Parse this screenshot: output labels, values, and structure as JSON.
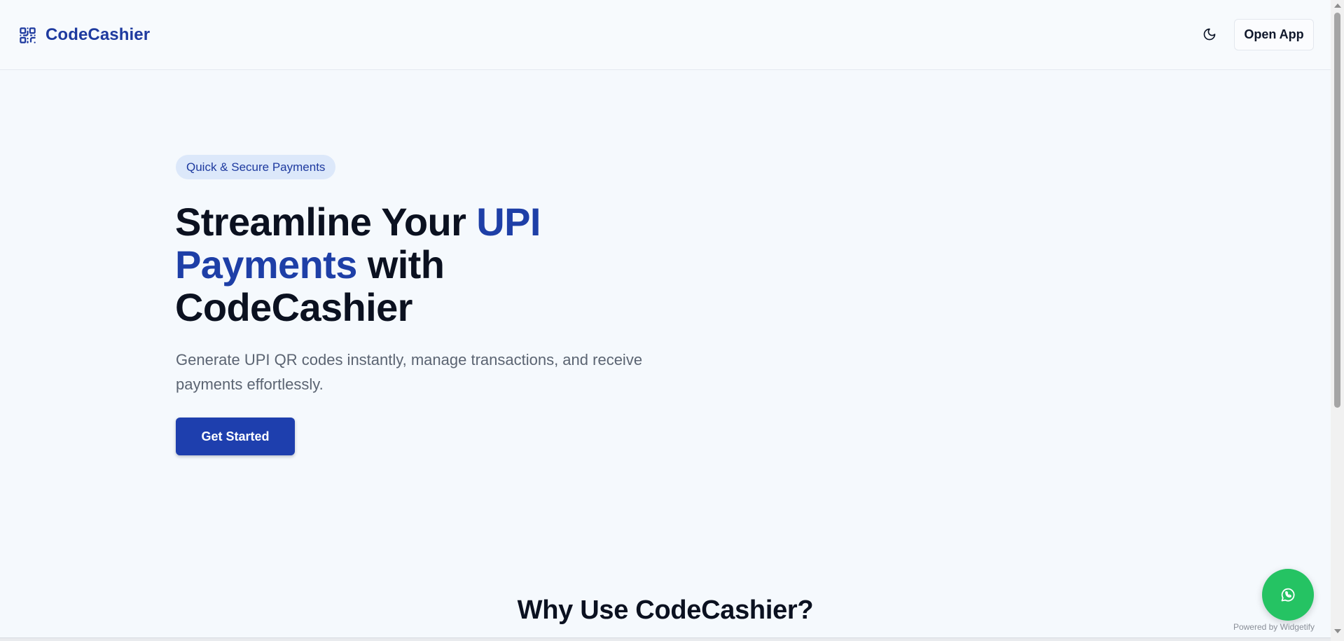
{
  "header": {
    "brand_name": "CodeCashier",
    "brand_icon": "qr-code-icon",
    "theme_toggle_icon": "moon-icon",
    "open_app_label": "Open App"
  },
  "hero": {
    "badge": "Quick & Secure Payments",
    "title_part1": "Streamline Your ",
    "title_accent": "UPI Payments",
    "title_part2": " with CodeCashier",
    "subtitle": "Generate UPI QR codes instantly, manage transactions, and receive payments effortlessly.",
    "cta_label": "Get Started"
  },
  "features": {
    "heading": "Why Use CodeCashier?"
  },
  "widget": {
    "icon": "whatsapp-icon",
    "powered_by": "Powered by Widgetify"
  },
  "colors": {
    "brand": "#1e3a9f",
    "cta": "#1e3fae",
    "badge_bg": "#dce8fa",
    "whatsapp": "#25c363",
    "page_bg": "#f5f9fd"
  }
}
